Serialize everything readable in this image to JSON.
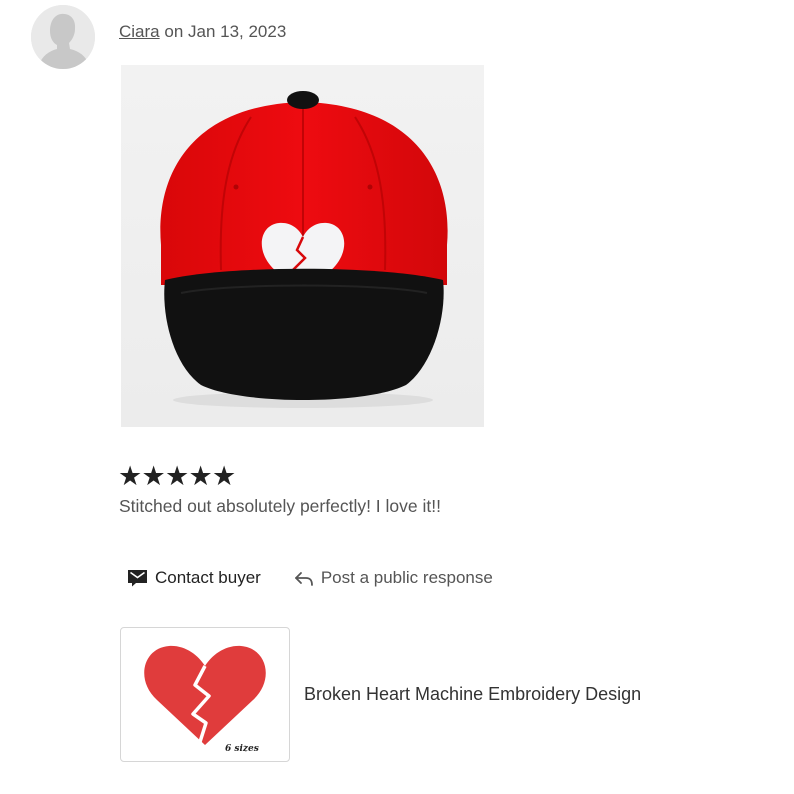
{
  "review": {
    "reviewer": "Ciara",
    "date_text": "on Jan 13, 2023",
    "rating": 5,
    "rating_max": 5,
    "star_glyph": "★",
    "text": "Stitched out absolutely perfectly! I love it!!",
    "photo_icon": "red-snapback-cap-with-broken-heart-photo"
  },
  "actions": {
    "contact_label": "Contact buyer",
    "contact_icon": "envelope-icon",
    "respond_label": "Post a public response",
    "respond_icon": "reply-arrow-icon"
  },
  "listing": {
    "title": "Broken Heart Machine Embroidery Design",
    "thumbnail_caption": "6 sizes",
    "thumbnail_icon": "broken-heart-icon"
  },
  "colors": {
    "cap_red": "#e8090d",
    "cap_brim": "#111111",
    "thumbnail_heart": "#e03c3c",
    "avatar_bg": "#e9e9e9",
    "avatar_silhouette": "#c8c8c8"
  }
}
